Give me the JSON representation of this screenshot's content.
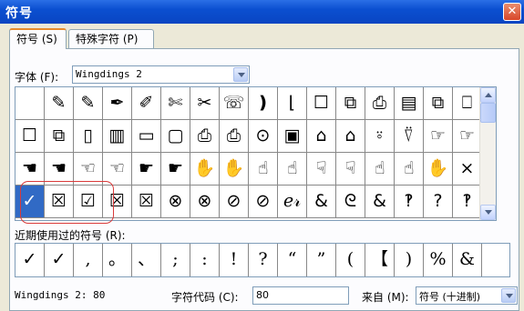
{
  "window": {
    "title": "符号",
    "close_glyph": "✕"
  },
  "tabs": [
    "符号 (S)",
    "特殊字符 (P)"
  ],
  "font": {
    "label": "字体 (F):",
    "value": "Wingdings 2"
  },
  "symbols": [
    [
      "",
      "✎",
      "✎",
      "✒",
      "✐",
      "✄",
      "✂",
      "☏",
      "❫",
      "⌊",
      "☐",
      "⧉",
      "⎙",
      "▤",
      "⧉",
      "⎕"
    ],
    [
      "☐",
      "⧉",
      "▯",
      "▥",
      "▭",
      "▢",
      "⎙",
      "⎙",
      "⊙",
      "▣",
      "⌂",
      "⌂",
      "⍤",
      "⍢",
      "☞",
      "☞"
    ],
    [
      "☚",
      "☚",
      "☜",
      "☜",
      "☛",
      "☛",
      "✋",
      "✋",
      "☝",
      "☝",
      "☟",
      "☟",
      "☝",
      "☝",
      "✋",
      "×"
    ],
    [
      "✓",
      "☒",
      "☑",
      "☒",
      "☒",
      "⊗",
      "⊗",
      "⊘",
      "⊘",
      "ℯ𝓇",
      "&",
      "ᘓ",
      "&",
      "‽",
      "?",
      "‽"
    ]
  ],
  "selected_index": 48,
  "recent": {
    "label": "近期使用过的符号 (R):",
    "items": [
      "✓",
      "✓",
      ",",
      "。",
      "、",
      ";",
      ":",
      "!",
      "?",
      "“",
      "”",
      "(",
      "【",
      ")",
      "%",
      "&"
    ]
  },
  "footer": {
    "name": "Wingdings 2: 80",
    "char_code_label": "字符代码 (C):",
    "char_code_value": "80",
    "from_label": "来自 (M):",
    "from_value": "符号 (十进制)"
  }
}
